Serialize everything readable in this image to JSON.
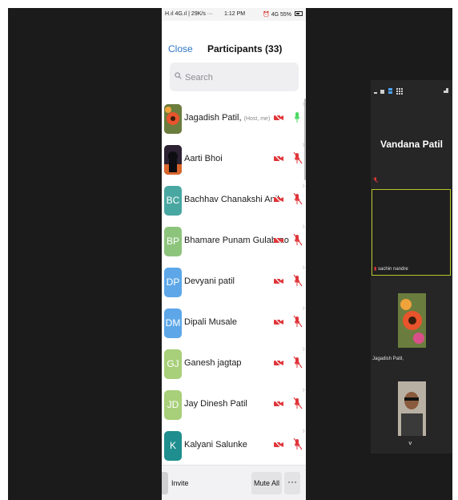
{
  "statusbar": {
    "left": "H.ıl 4G.ıl | 29K/s ···",
    "time": "1:12 PM",
    "right": "⏰ 4G 55%"
  },
  "header": {
    "close_label": "Close",
    "title": "Participants (33)"
  },
  "search": {
    "placeholder": "Search"
  },
  "participants": [
    {
      "name": "Jagadish Patil,",
      "tag": "(Host, me)",
      "initials": "",
      "avatar_color": "#c0392b",
      "video": "off",
      "mic": "on"
    },
    {
      "name": "Aarti Bhoi",
      "tag": "",
      "initials": "",
      "avatar_color": "#2d2233",
      "video": "off",
      "mic": "off"
    },
    {
      "name": "Bachhav Chanakshi Anil",
      "tag": "",
      "initials": "BC",
      "avatar_color": "#49a7a1",
      "video": "off",
      "mic": "off"
    },
    {
      "name": "Bhamare Punam Gulabrao",
      "tag": "",
      "initials": "BP",
      "avatar_color": "#8dc47c",
      "video": "off",
      "mic": "off"
    },
    {
      "name": "Devyani patil",
      "tag": "",
      "initials": "DP",
      "avatar_color": "#5da7e8",
      "video": "off",
      "mic": "off"
    },
    {
      "name": "Dipali Musale",
      "tag": "",
      "initials": "DM",
      "avatar_color": "#5da7e8",
      "video": "off",
      "mic": "off"
    },
    {
      "name": "Ganesh jagtap",
      "tag": "",
      "initials": "GJ",
      "avatar_color": "#a8cf79",
      "video": "off",
      "mic": "off"
    },
    {
      "name": "Jay Dinesh Patil",
      "tag": "",
      "initials": "JD",
      "avatar_color": "#a8cf79",
      "video": "off",
      "mic": "off"
    },
    {
      "name": "Kalyani Salunke",
      "tag": "",
      "initials": "K",
      "avatar_color": "#1e8e8e",
      "video": "off",
      "mic": "off"
    }
  ],
  "bottombar": {
    "invite_label": "Invite",
    "mute_all_label": "Mute All",
    "more_label": "···"
  },
  "side_panel": {
    "speaker_name": "Vandana Patil",
    "active_tile_label": "sachin nandre",
    "photo_tile_label": "Jagadish Patil,",
    "down_label": "˅"
  },
  "colors": {
    "accent": "#2d74c4",
    "muted_red": "#e0353a",
    "mic_green": "#4cd964",
    "active_border": "#b7c72a"
  }
}
